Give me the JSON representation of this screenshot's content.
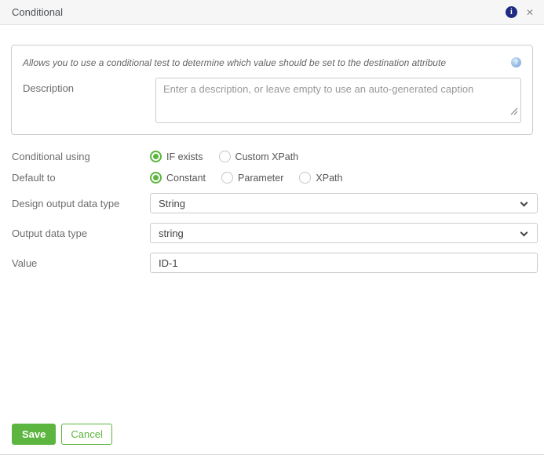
{
  "dialog": {
    "title": "Conditional"
  },
  "icons": {
    "info_glyph": "i",
    "close_glyph": "✕",
    "help_glyph": "?"
  },
  "intro_text": "Allows you to use a conditional test to determine which value should be set to the destination attribute",
  "form": {
    "description": {
      "label": "Description",
      "value": "",
      "placeholder": "Enter a description, or leave empty to use an auto-generated caption"
    },
    "conditional_using": {
      "label": "Conditional using",
      "options": [
        {
          "label": "IF exists",
          "selected": true
        },
        {
          "label": "Custom XPath",
          "selected": false
        }
      ]
    },
    "default_to": {
      "label": "Default to",
      "options": [
        {
          "label": "Constant",
          "selected": true
        },
        {
          "label": "Parameter",
          "selected": false
        },
        {
          "label": "XPath",
          "selected": false
        }
      ]
    },
    "design_output_data_type": {
      "label": "Design output data type",
      "value": "String"
    },
    "output_data_type": {
      "label": "Output data type",
      "value": "string"
    },
    "value_field": {
      "label": "Value",
      "value": "ID-1"
    }
  },
  "footer": {
    "save_label": "Save",
    "cancel_label": "Cancel"
  },
  "colors": {
    "accent_green": "#5cb53f",
    "info_icon_navy": "#1f2b81",
    "help_icon_blue": "#6f9fd8"
  }
}
